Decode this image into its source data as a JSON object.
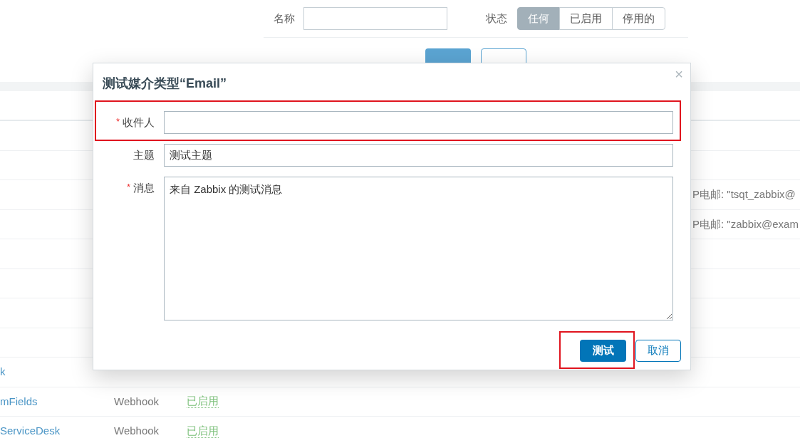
{
  "filter": {
    "name_label": "名称",
    "status_label": "状态",
    "status_options": [
      {
        "label": "任何",
        "selected": true
      },
      {
        "label": "已启用",
        "selected": false
      },
      {
        "label": "停用的",
        "selected": false
      }
    ],
    "apply_enabled": true
  },
  "table": {
    "rows": [
      {
        "kind": "empty"
      },
      {
        "kind": "empty"
      },
      {
        "kind": "detail",
        "detail": "P电邮: \"tsqt_zabbix@"
      },
      {
        "kind": "detail",
        "detail": "P电邮: \"zabbix@exam"
      },
      {
        "kind": "empty"
      },
      {
        "kind": "empty"
      },
      {
        "kind": "empty"
      },
      {
        "kind": "empty"
      },
      {
        "kind": "media",
        "name": "k"
      },
      {
        "kind": "media",
        "name": "mFields",
        "type": "Webhook",
        "status": "已启用"
      },
      {
        "kind": "media",
        "name": "ServiceDesk",
        "type": "Webhook",
        "status": "已启用"
      }
    ]
  },
  "dialog": {
    "title": "测试媒介类型“Email”",
    "close": "×",
    "required_mark": "*",
    "fields": [
      {
        "kind": "input",
        "label": "收件人",
        "required": true,
        "highlighted": true
      },
      {
        "kind": "input",
        "label": "主题",
        "required": false,
        "value": "测试主题",
        "highlighted": false
      },
      {
        "kind": "textarea",
        "label": "消息",
        "required": true,
        "value": "来自 Zabbix 的测试消息",
        "highlighted": false
      }
    ],
    "test": "测试",
    "cancel": "取消"
  }
}
